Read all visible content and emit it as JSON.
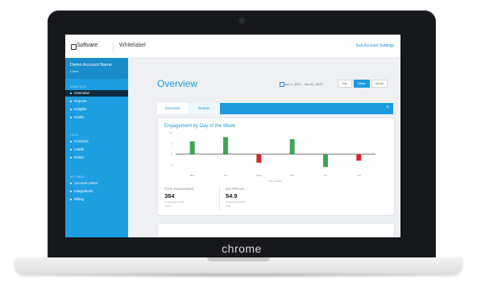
{
  "device": {
    "brand_text": "chrome"
  },
  "topbar": {
    "logo_text": "Softvare",
    "product_text": "Whitelabel",
    "top_link": "Sub Account Settings"
  },
  "sidebar": {
    "account_name": "Demo Account Name",
    "account_sub": "Client",
    "sections": [
      {
        "heading": "ANALYTICS",
        "items": [
          {
            "label": "Overview",
            "active": true
          },
          {
            "label": "Reports",
            "active": false
          },
          {
            "label": "Insights",
            "active": false
          },
          {
            "label": "Goals",
            "active": false
          }
        ]
      },
      {
        "heading": "LISTS",
        "items": [
          {
            "label": "Contacts",
            "active": false
          },
          {
            "label": "Leads",
            "active": false
          },
          {
            "label": "Notes",
            "active": false
          }
        ]
      },
      {
        "heading": "SETTINGS",
        "items": [
          {
            "label": "Account Users",
            "active": false
          },
          {
            "label": "Integrations",
            "active": false
          },
          {
            "label": "Billing",
            "active": false
          }
        ]
      }
    ]
  },
  "main": {
    "page_title": "Overview",
    "date_label": "Jan 1, 2017 - Jan 31, 2017",
    "range_buttons": [
      {
        "label": "Day",
        "selected": false
      },
      {
        "label": "Week",
        "selected": true
      },
      {
        "label": "Month",
        "selected": false
      }
    ],
    "tabs": [
      {
        "label": "Overview",
        "active": true
      },
      {
        "label": "Details",
        "active": false
      }
    ],
    "tool_button_label": "+"
  },
  "card": {
    "title": "Engagement by Day of the Week",
    "metrics": [
      {
        "label": "TOTAL ENGAGEMENT",
        "value": "384",
        "sub": "vs previous period",
        "sub2": "+12%"
      },
      {
        "label": "AVG PER DAY",
        "value": "54.9",
        "sub": "vs previous period",
        "sub2": "+4%"
      }
    ]
  },
  "colors": {
    "accent": "#1e9be0",
    "sidebar": "#1d9ee0",
    "active_nav": "#0f2b40",
    "positive": "#3ea556",
    "negative": "#d9262b"
  },
  "chart_data": {
    "type": "bar",
    "title": "Engagement by Day of the Week",
    "xlabel": "Day of Week",
    "ylabel": "",
    "categories": [
      "Mon",
      "Tue",
      "Wed",
      "Thu",
      "Fri",
      "Sat"
    ],
    "values": [
      6,
      8,
      -4,
      7,
      -6,
      -3
    ],
    "ylim": [
      -8,
      10
    ],
    "bar_colors": [
      "#3ea556",
      "#3ea556",
      "#d9262b",
      "#3ea556",
      "#3ea556",
      "#d9262b"
    ],
    "yticks": [
      "10",
      "5",
      "0",
      "-5"
    ],
    "grid": false,
    "legend": "none"
  }
}
